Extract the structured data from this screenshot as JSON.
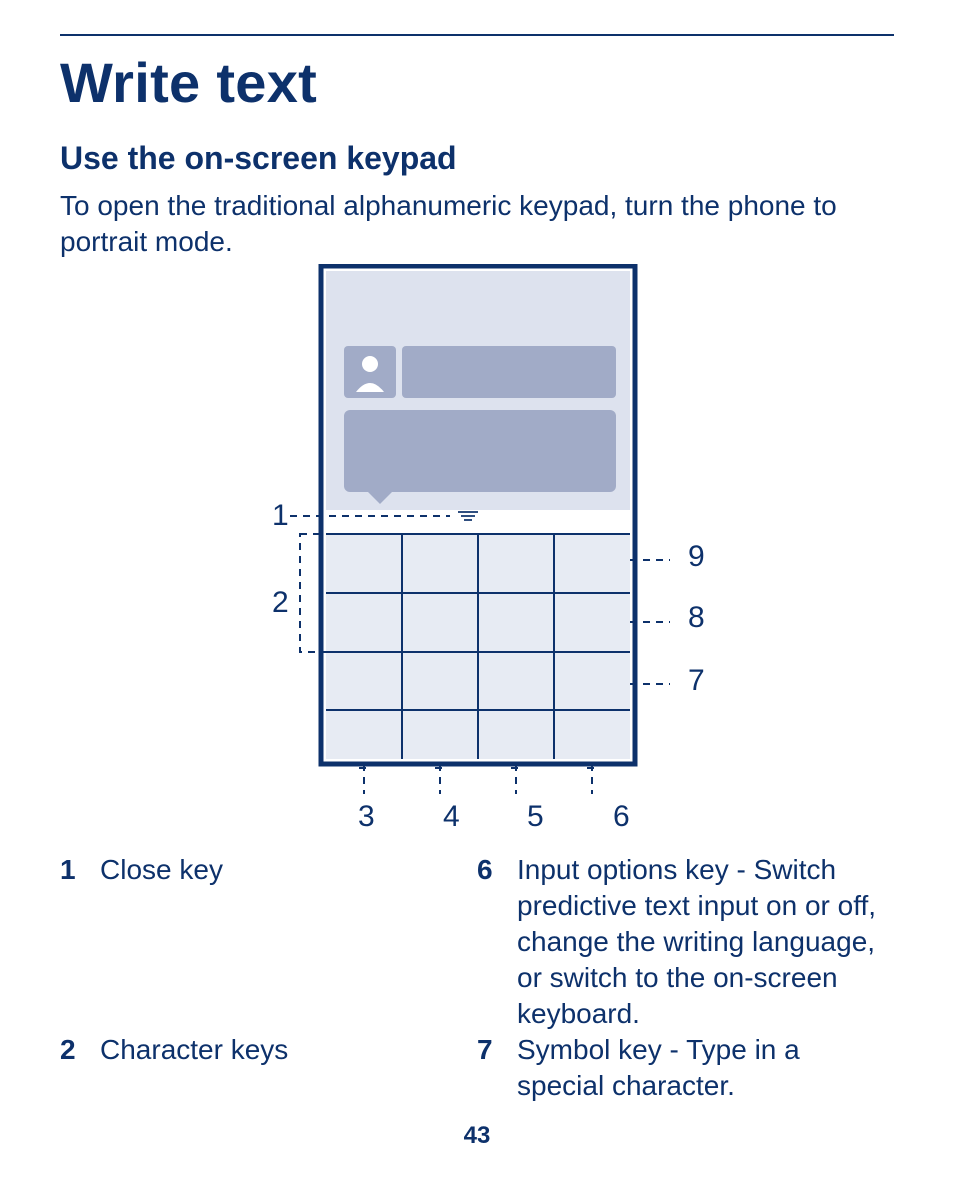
{
  "h1": "Write text",
  "h2": "Use the on-screen keypad",
  "intro": "To open the traditional alphanumeric keypad, turn the phone to portrait mode.",
  "callouts": {
    "n1": "1",
    "n2": "2",
    "n3": "3",
    "n4": "4",
    "n5": "5",
    "n6": "6",
    "n7": "7",
    "n8": "8",
    "n9": "9"
  },
  "legend": {
    "i1": {
      "n": "1",
      "t": "Close key"
    },
    "i2": {
      "n": "2",
      "t": "Character keys"
    },
    "i6": {
      "n": "6",
      "t": "Input options key - Switch predictive text input on or off, change the writing language, or switch to the on-screen keyboard."
    },
    "i7": {
      "n": "7",
      "t": "Symbol key - Type in a special character."
    }
  },
  "page_number": "43"
}
